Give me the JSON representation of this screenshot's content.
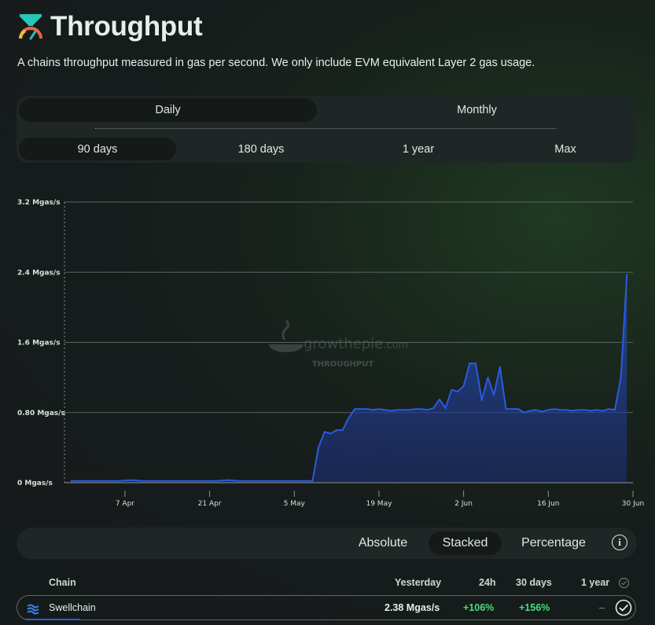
{
  "header": {
    "title": "Throughput",
    "subtitle": "A chains throughput measured in gas per second. We only include EVM equivalent Layer 2 gas usage."
  },
  "controls": {
    "interval_tabs": [
      {
        "label": "Daily",
        "active": true
      },
      {
        "label": "Monthly",
        "active": false
      }
    ],
    "range_tabs": [
      {
        "label": "90 days",
        "active": true
      },
      {
        "label": "180 days",
        "active": false
      },
      {
        "label": "1 year",
        "active": false
      },
      {
        "label": "Max",
        "active": false
      }
    ]
  },
  "watermark": {
    "brand": "growthepie",
    "brand_suffix": ".com",
    "caption": "THROUGHPUT"
  },
  "chart_data": {
    "type": "area",
    "ylabel": "",
    "xlabel": "",
    "y_unit": "Mgas/s",
    "ylim": [
      0,
      3.2
    ],
    "y_ticks": [
      {
        "value": 0,
        "label": "0 Mgas/s"
      },
      {
        "value": 0.8,
        "label": "0.80 Mgas/s"
      },
      {
        "value": 1.6,
        "label": "1.6 Mgas/s"
      },
      {
        "value": 2.4,
        "label": "2.4 Mgas/s"
      },
      {
        "value": 3.2,
        "label": "3.2 Mgas/s"
      }
    ],
    "x_ticks": [
      {
        "date": "2025-04-07",
        "label": "7 Apr"
      },
      {
        "date": "2025-04-21",
        "label": "21 Apr"
      },
      {
        "date": "2025-05-05",
        "label": "5 May"
      },
      {
        "date": "2025-05-19",
        "label": "19 May"
      },
      {
        "date": "2025-06-02",
        "label": "2 Jun"
      },
      {
        "date": "2025-06-16",
        "label": "16 Jun"
      },
      {
        "date": "2025-06-30",
        "label": "30 Jun"
      }
    ],
    "x_start": "2025-03-28",
    "x_end": "2025-06-30",
    "grid": true,
    "color": "#2b5bde",
    "series": [
      {
        "name": "Swellchain",
        "x": [
          "2025-03-29",
          "2025-03-31",
          "2025-04-02",
          "2025-04-04",
          "2025-04-06",
          "2025-04-08",
          "2025-04-10",
          "2025-04-12",
          "2025-04-14",
          "2025-04-16",
          "2025-04-18",
          "2025-04-20",
          "2025-04-22",
          "2025-04-24",
          "2025-04-26",
          "2025-04-28",
          "2025-04-30",
          "2025-05-02",
          "2025-05-04",
          "2025-05-06",
          "2025-05-08",
          "2025-05-09",
          "2025-05-10",
          "2025-05-11",
          "2025-05-12",
          "2025-05-13",
          "2025-05-14",
          "2025-05-15",
          "2025-05-16",
          "2025-05-17",
          "2025-05-18",
          "2025-05-19",
          "2025-05-20",
          "2025-05-21",
          "2025-05-22",
          "2025-05-23",
          "2025-05-24",
          "2025-05-25",
          "2025-05-26",
          "2025-05-27",
          "2025-05-28",
          "2025-05-29",
          "2025-05-30",
          "2025-05-31",
          "2025-06-01",
          "2025-06-02",
          "2025-06-03",
          "2025-06-04",
          "2025-06-05",
          "2025-06-06",
          "2025-06-07",
          "2025-06-08",
          "2025-06-09",
          "2025-06-10",
          "2025-06-11",
          "2025-06-12",
          "2025-06-13",
          "2025-06-14",
          "2025-06-15",
          "2025-06-16",
          "2025-06-17",
          "2025-06-18",
          "2025-06-19",
          "2025-06-20",
          "2025-06-21",
          "2025-06-22",
          "2025-06-23",
          "2025-06-24",
          "2025-06-25",
          "2025-06-26",
          "2025-06-27",
          "2025-06-28",
          "2025-06-29"
        ],
        "values": [
          0.02,
          0.02,
          0.02,
          0.02,
          0.02,
          0.03,
          0.02,
          0.02,
          0.02,
          0.02,
          0.02,
          0.02,
          0.02,
          0.03,
          0.02,
          0.02,
          0.02,
          0.02,
          0.02,
          0.02,
          0.02,
          0.4,
          0.58,
          0.56,
          0.6,
          0.6,
          0.74,
          0.84,
          0.84,
          0.84,
          0.83,
          0.84,
          0.83,
          0.82,
          0.83,
          0.83,
          0.83,
          0.84,
          0.84,
          0.83,
          0.85,
          0.95,
          0.85,
          1.06,
          1.04,
          1.1,
          1.36,
          1.36,
          0.94,
          1.2,
          1.0,
          1.32,
          0.84,
          0.84,
          0.84,
          0.8,
          0.82,
          0.83,
          0.81,
          0.83,
          0.84,
          0.83,
          0.83,
          0.82,
          0.83,
          0.83,
          0.82,
          0.83,
          0.82,
          0.84,
          0.83,
          1.2,
          2.38
        ]
      }
    ]
  },
  "modes": [
    {
      "label": "Absolute",
      "active": false
    },
    {
      "label": "Stacked",
      "active": true
    },
    {
      "label": "Percentage",
      "active": false
    }
  ],
  "table": {
    "headers": {
      "chain": "Chain",
      "yesterday": "Yesterday",
      "h24": "24h",
      "d30": "30 days",
      "y1": "1 year"
    },
    "rows": [
      {
        "chain": "Swellchain",
        "yesterday": "2.38 Mgas/s",
        "h24": "+106%",
        "d30": "+156%",
        "y1": "–",
        "color": "#2b5bde"
      }
    ]
  }
}
